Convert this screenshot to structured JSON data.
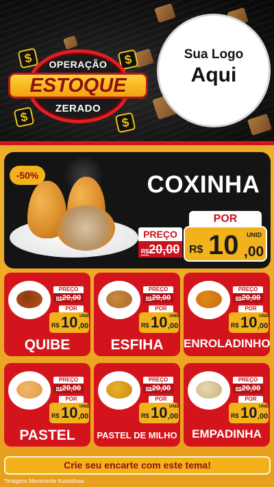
{
  "header": {
    "badge_top": "OPERAÇÃO",
    "badge_main": "ESTOQUE",
    "badge_bottom": "ZERADO",
    "logo_line1": "Sua Logo",
    "logo_line2": "Aqui",
    "dollar_symbol": "$"
  },
  "hero": {
    "discount": "-50%",
    "title": "COXINHA",
    "preco_label": "PREÇO",
    "old_price": "R$20,00",
    "old_prefix": "R$",
    "old_value": "20,00",
    "por_label": "POR",
    "currency": "R$",
    "price_int": "10",
    "price_cents": ",00",
    "unit": "UNID"
  },
  "cards": [
    {
      "name": "QUIBE",
      "preco_label": "PREÇO",
      "old_prefix": "R$",
      "old_value": "20,00",
      "por_label": "POR",
      "currency": "R$",
      "price_int": "10",
      "price_cents": ",00",
      "unit": "UNID"
    },
    {
      "name": "ESFIHA",
      "preco_label": "PREÇO",
      "old_prefix": "R$",
      "old_value": "20,00",
      "por_label": "POR",
      "currency": "R$",
      "price_int": "10",
      "price_cents": ",00",
      "unit": "UNID"
    },
    {
      "name": "ENROLADINHO",
      "preco_label": "PREÇO",
      "old_prefix": "R$",
      "old_value": "20,00",
      "por_label": "POR",
      "currency": "R$",
      "price_int": "10",
      "price_cents": ",00",
      "unit": "UNID"
    },
    {
      "name": "PASTEL",
      "preco_label": "PREÇO",
      "old_prefix": "R$",
      "old_value": "20,00",
      "por_label": "POR",
      "currency": "R$",
      "price_int": "10",
      "price_cents": ",00",
      "unit": "UNID"
    },
    {
      "name": "PASTEL DE MILHO",
      "preco_label": "PREÇO",
      "old_prefix": "R$",
      "old_value": "20,00",
      "por_label": "POR",
      "currency": "R$",
      "price_int": "10",
      "price_cents": ",00",
      "unit": "UNID"
    },
    {
      "name": "EMPADINHA",
      "preco_label": "PREÇO",
      "old_prefix": "R$",
      "old_value": "20,00",
      "por_label": "POR",
      "currency": "R$",
      "price_int": "10",
      "price_cents": ",00",
      "unit": "UNID"
    }
  ],
  "cta": {
    "label": "Crie seu encarte com este tema!"
  },
  "footer": {
    "disclaimer": "*Imagens Meramente Ilustrativas"
  },
  "colors": {
    "brand_red": "#d4141c",
    "accent_yellow": "#f2b21b",
    "dark": "#141414"
  }
}
